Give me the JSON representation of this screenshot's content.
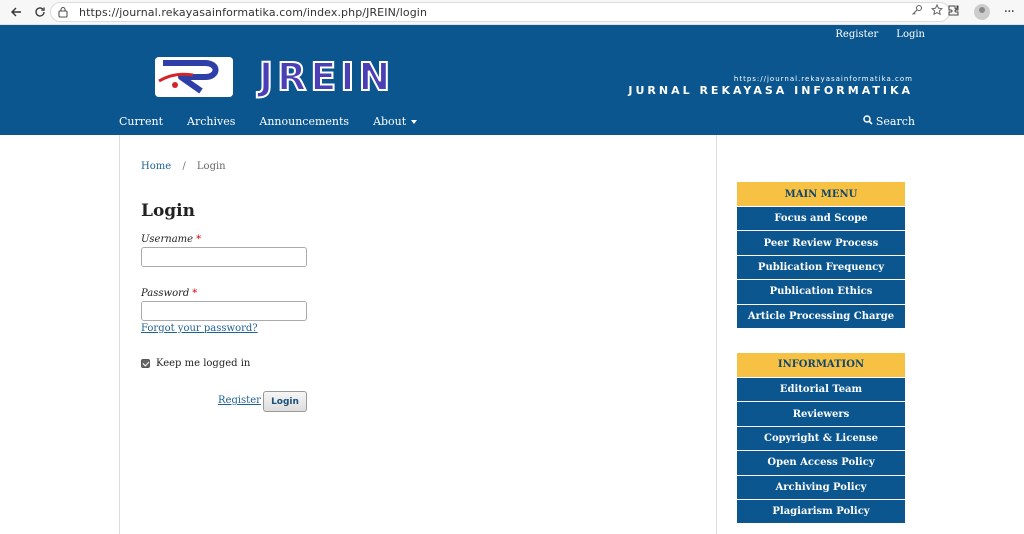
{
  "browser": {
    "url": "https://journal.rekayasainformatika.com/index.php/JREIN/login"
  },
  "header": {
    "user_links": [
      "Register",
      "Login"
    ],
    "logo_word": "JREIN",
    "logo_url_text": "https://journal.rekayasainformatika.com",
    "logo_subtitle": "JURNAL REKAYASA INFORMATIKA",
    "brand_color": "#0b568f",
    "accent_color": "#f7c244"
  },
  "nav": {
    "items": [
      "Current",
      "Archives",
      "Announcements",
      "About"
    ],
    "search_label": "Search"
  },
  "breadcrumb": {
    "home": "Home",
    "separator": "/",
    "current": "Login"
  },
  "login_form": {
    "title": "Login",
    "username_label": "Username",
    "password_label": "Password",
    "required_mark": "*",
    "username_value": "",
    "password_value": "",
    "forgot_label": "Forgot your password?",
    "keep_logged_in_label": "Keep me logged in",
    "keep_logged_in_checked": true,
    "register_label": "Register",
    "login_button_label": "Login"
  },
  "sidebar": {
    "main_menu": {
      "title": "MAIN MENU",
      "items": [
        "Focus and Scope",
        "Peer Review Process",
        "Publication Frequency",
        "Publication Ethics",
        "Article Processing Charge"
      ]
    },
    "information": {
      "title": "INFORMATION",
      "items": [
        "Editorial Team",
        "Reviewers",
        "Copyright & License",
        "Open Access Policy",
        "Archiving Policy",
        "Plagiarism Policy"
      ]
    }
  }
}
